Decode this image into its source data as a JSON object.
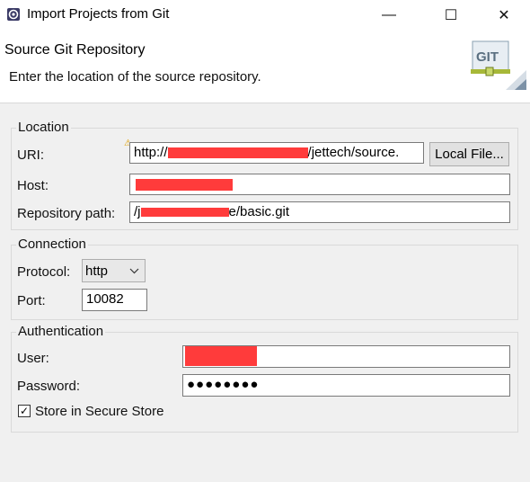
{
  "window": {
    "title": "Import Projects from Git",
    "minimize_glyph": "—",
    "maximize_glyph": "☐",
    "close_glyph": "✕"
  },
  "header": {
    "title": "Source Git Repository",
    "description": "Enter the location of the source repository.",
    "logo_text": "GIT"
  },
  "location": {
    "label": "Location",
    "uri_label": "URI:",
    "uri_value": "http://",
    "uri_value_suffix": "/jettech/source.",
    "local_file_button": "Local File...",
    "host_label": "Host:",
    "host_value": "",
    "repo_path_label": "Repository path:",
    "repo_path_prefix": "/j",
    "repo_path_suffix": "e/basic.git"
  },
  "connection": {
    "label": "Connection",
    "protocol_label": "Protocol:",
    "protocol_value": "http",
    "port_label": "Port:",
    "port_value": "10082"
  },
  "authentication": {
    "label": "Authentication",
    "user_label": "User:",
    "user_value": "",
    "password_label": "Password:",
    "password_value": "●●●●●●●●",
    "store_label": "Store in Secure Store",
    "store_checked": true
  },
  "colors": {
    "redaction": "#ff3b3b",
    "background": "#f0f0f0",
    "accent": "#7a7a7a"
  }
}
